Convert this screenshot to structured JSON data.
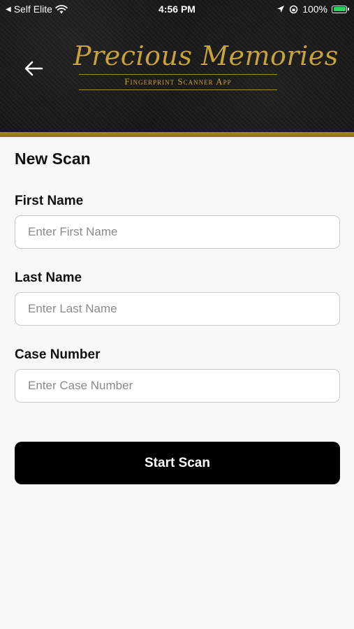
{
  "status_bar": {
    "carrier": "Self Elite",
    "time": "4:56 PM",
    "battery": "100%"
  },
  "header": {
    "logo_title": "Precious Memories",
    "logo_subtitle": "Fingerprint Scanner App",
    "back_icon": "arrow-left-icon",
    "accent_color": "#a8891f"
  },
  "form": {
    "title": "New Scan",
    "first_name": {
      "label": "First Name",
      "placeholder": "Enter First Name",
      "value": ""
    },
    "last_name": {
      "label": "Last Name",
      "placeholder": "Enter Last Name",
      "value": ""
    },
    "case_number": {
      "label": "Case Number",
      "placeholder": "Enter Case Number",
      "value": ""
    },
    "submit_label": "Start Scan"
  }
}
